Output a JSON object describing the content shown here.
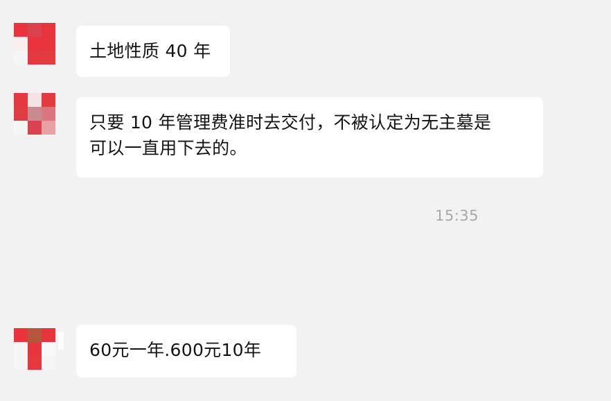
{
  "chat": {
    "messages": [
      {
        "lines": [
          "土地性质 40 年"
        ]
      },
      {
        "lines": [
          "只要 10 年管理费准时去交付，不被认定为无主墓是",
          "可以一直用下去的。"
        ]
      },
      {
        "lines": [
          "60元一年.600元10年"
        ]
      }
    ],
    "timestamp": "15:35"
  },
  "avatars": {
    "avatar_1_colors": [
      "#e8343c",
      "#d9434f",
      "#e8343c",
      "#fbeeee",
      "#e8343c",
      "#e8343c",
      "#f5f5f5",
      "#e43a3e",
      "#e23b40"
    ],
    "avatar_2_colors": [
      "#e33a40",
      "#f5e3e4",
      "#e33a40",
      "#e03d42",
      "#c98a90",
      "#d9777d",
      "#f5f5f5",
      "#d9434f",
      "#e8a2a6"
    ],
    "avatar_3_colors": [
      "#e8343c",
      "#b3583c",
      "#e8343c",
      "#f5f5f5",
      "#e8343c",
      "#f8f8f8",
      "#f5f5f5",
      "#e43a3e",
      "#f5f5f5"
    ]
  }
}
